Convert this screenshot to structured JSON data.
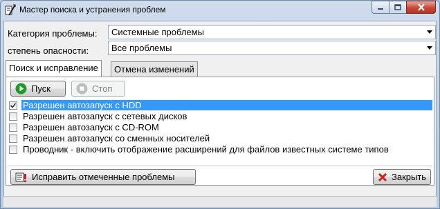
{
  "window": {
    "title": "Мастер поиска и устранения проблем",
    "icon": "wizard-icon",
    "controls": [
      "minimize-icon",
      "maximize-icon",
      "close-icon"
    ]
  },
  "filters": {
    "category_label": "Категория проблемы:",
    "category_value": "Системные проблемы",
    "severity_label": "степень опасности:",
    "severity_value": "Все проблемы"
  },
  "tabs": [
    {
      "label": "Поиск и исправление",
      "active": true
    },
    {
      "label": "Отмена изменений",
      "active": false
    }
  ],
  "toolbar": {
    "start_label": "Пуск",
    "stop_label": "Стоп"
  },
  "problems": [
    {
      "label": "Разрешен автозапуск с HDD",
      "checked": true,
      "selected": true
    },
    {
      "label": "Разрешен автозапуск с сетевых дисков",
      "checked": false,
      "selected": false
    },
    {
      "label": "Разрешен автозапуск с CD-ROM",
      "checked": false,
      "selected": false
    },
    {
      "label": "Разрешен автозапуск со сменных носителей",
      "checked": false,
      "selected": false
    },
    {
      "label": "Проводник - включить отображение расширений для файлов известных системе типов",
      "checked": false,
      "selected": false
    }
  ],
  "actions": {
    "fix_label": "Исправить отмеченные проблемы",
    "close_label": "Закрыть"
  },
  "colors": {
    "selection": "#3399ff",
    "play": "#1f9a2a",
    "close_x": "#c8251b"
  }
}
